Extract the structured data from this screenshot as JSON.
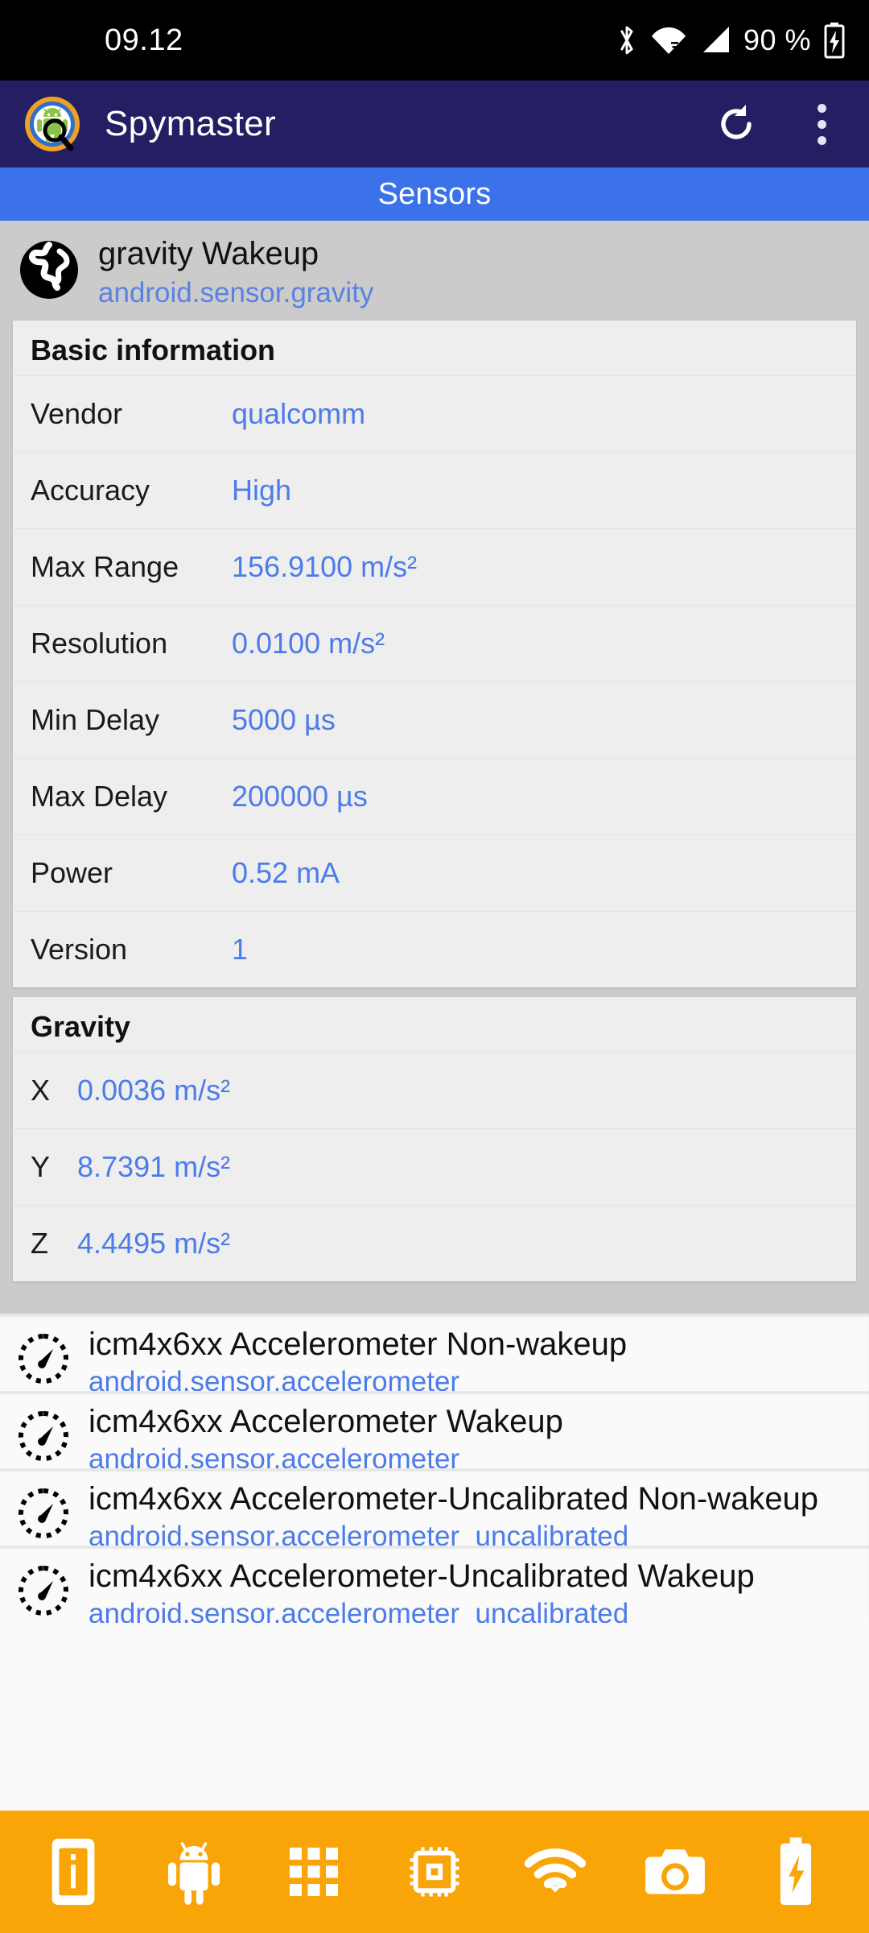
{
  "status_bar": {
    "time": "09.12",
    "battery_percent": "90 %",
    "icons": [
      "bluetooth-icon",
      "wifi-icon",
      "cellular-signal-icon",
      "battery-charging-icon"
    ]
  },
  "app_bar": {
    "title": "Spymaster",
    "logo": "spymaster-logo-icon",
    "refresh_label": "refresh-icon",
    "menu_label": "overflow-menu-icon",
    "background_color": "#241f63"
  },
  "tab_bar": {
    "selected_tab": "Sensors",
    "background_color": "#3b72ea"
  },
  "expanded_sensor": {
    "icon": "globe-icon",
    "title": "gravity  Wakeup",
    "type": "android.sensor.gravity",
    "basic_information": {
      "heading": "Basic information",
      "rows": [
        {
          "key": "Vendor",
          "value": "qualcomm"
        },
        {
          "key": "Accuracy",
          "value": "High"
        },
        {
          "key": "Max Range",
          "value": "156.9100 m/s²"
        },
        {
          "key": "Resolution",
          "value": "0.0100 m/s²"
        },
        {
          "key": "Min Delay",
          "value": "5000 µs"
        },
        {
          "key": "Max Delay",
          "value": "200000 µs"
        },
        {
          "key": "Power",
          "value": "0.52 mA"
        },
        {
          "key": "Version",
          "value": "1"
        }
      ]
    },
    "readings": {
      "heading": "Gravity",
      "rows": [
        {
          "key": "X",
          "value": "0.0036 m/s²"
        },
        {
          "key": "Y",
          "value": "8.7391 m/s²"
        },
        {
          "key": "Z",
          "value": "4.4495 m/s²"
        }
      ]
    }
  },
  "sensor_list": [
    {
      "icon": "speedometer-icon",
      "title": "icm4x6xx Accelerometer Non-wakeup",
      "type": "android.sensor.accelerometer"
    },
    {
      "icon": "speedometer-icon",
      "title": "icm4x6xx Accelerometer Wakeup",
      "type": "android.sensor.accelerometer"
    },
    {
      "icon": "speedometer-icon",
      "title": "icm4x6xx Accelerometer-Uncalibrated Non-wakeup",
      "type": "android.sensor.accelerometer_uncalibrated"
    },
    {
      "icon": "speedometer-icon",
      "title": "icm4x6xx Accelerometer-Uncalibrated Wakeup",
      "type": "android.sensor.accelerometer_uncalibrated"
    }
  ],
  "bottom_nav": {
    "background_color": "#f9a407",
    "items": [
      {
        "icon": "device-info-icon"
      },
      {
        "icon": "android-robot-icon"
      },
      {
        "icon": "apps-grid-icon"
      },
      {
        "icon": "cpu-chip-icon"
      },
      {
        "icon": "wifi-icon"
      },
      {
        "icon": "camera-icon"
      },
      {
        "icon": "battery-icon"
      }
    ]
  },
  "colors": {
    "accent_blue": "#4c7cea",
    "app_bar": "#241f63",
    "tab_bar": "#3b72ea",
    "nav_orange": "#f9a407"
  }
}
